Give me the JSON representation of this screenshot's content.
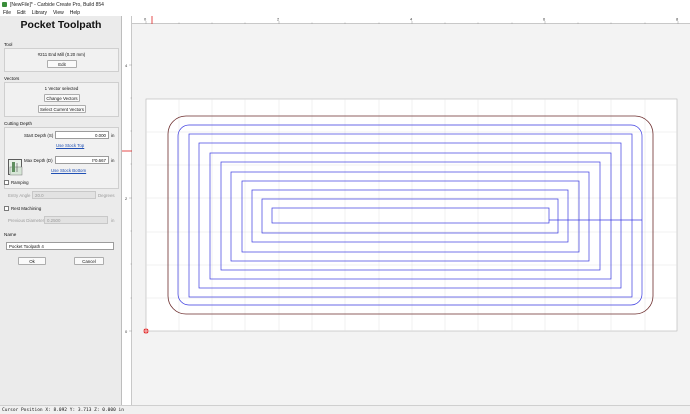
{
  "window": {
    "title": "[NewFile]* - Carbide Create Pro, Build 854"
  },
  "menu": {
    "items": [
      "File",
      "Edit",
      "Library",
      "View",
      "Help"
    ]
  },
  "panel": {
    "title": "Pocket Toolpath",
    "tool": {
      "section_label": "Tool",
      "tool_name": "#211 End Mill (0.20 mm)",
      "edit_label": "Edit"
    },
    "vectors": {
      "section_label": "Vectors",
      "selected_text": "1 Vector selected",
      "change_label": "Change Vectors",
      "select_current_label": "Select Current Vectors"
    },
    "cutting_depth": {
      "section_label": "Cutting Depth",
      "start_label": "Start Depth (S)",
      "start_value": "0.000",
      "start_unit": "in",
      "use_stock_top": "Use Stock Top",
      "max_label": "Max Depth (D)",
      "max_value": "t*0.667",
      "max_unit": "in",
      "use_stock_bottom": "Use Stock Bottom"
    },
    "ramping": {
      "label": "Ramping",
      "entry_angle_label": "Entry Angle",
      "entry_angle_value": "20.0",
      "entry_angle_unit": "Degrees"
    },
    "rest_machining": {
      "label": "Rest Machining",
      "prev_diameter_label": "Previous Diameter",
      "prev_diameter_value": "0.2500",
      "prev_diameter_unit": "in"
    },
    "name": {
      "section_label": "Name",
      "value": "Pocket Toolpath 4"
    },
    "ok_label": "Ok",
    "cancel_label": "Cancel"
  },
  "rulers": {
    "top_ticks": [
      "0",
      "2",
      "4",
      "6",
      "8"
    ],
    "left_ticks": [
      "4",
      "2",
      "0"
    ]
  },
  "colors": {
    "toolpath": "#3a3ae0",
    "boundary": "#6b2b2b",
    "origin": "#e02020"
  },
  "status": {
    "text": "Cursor Position X: 8.092 Y: 3.713 Z: 0.000 in"
  }
}
